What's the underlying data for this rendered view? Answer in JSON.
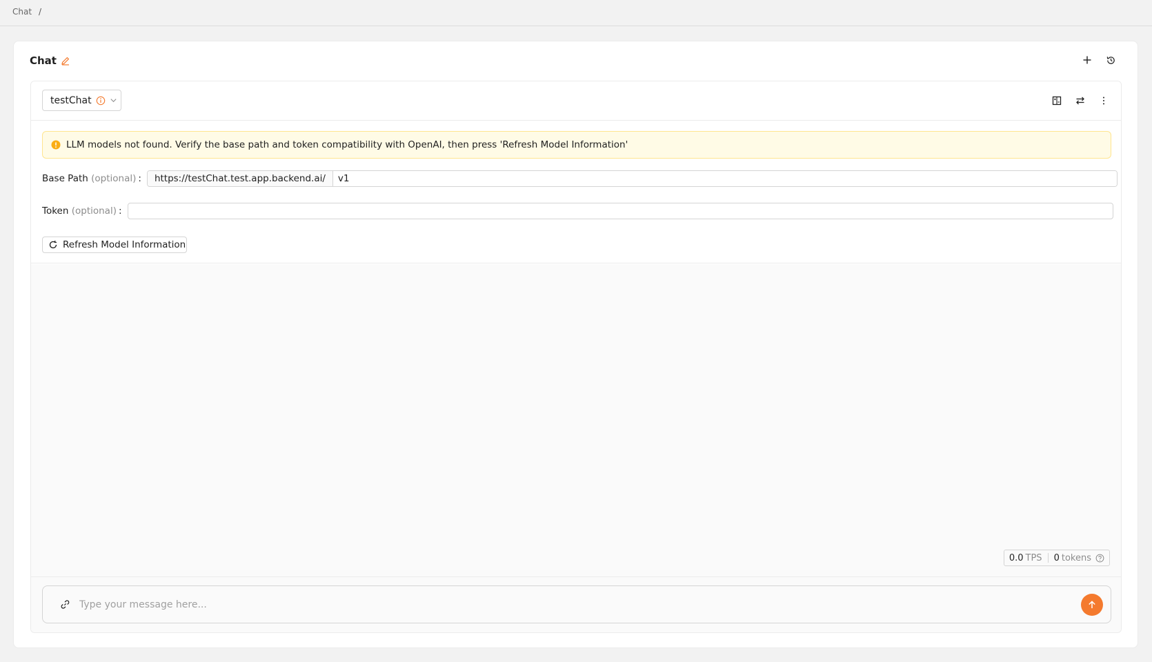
{
  "breadcrumb": {
    "root": "Chat",
    "separator": "/"
  },
  "card": {
    "title": "Chat"
  },
  "model_select": {
    "value": "testChat"
  },
  "alert": {
    "message": "LLM models not found. Verify the base path and token compatibility with OpenAI, then press 'Refresh Model Information'"
  },
  "base_path": {
    "label": "Base Path",
    "optional": "(optional)",
    "colon": ":",
    "prefix": "https://testChat.test.app.backend.ai/",
    "value": "v1"
  },
  "token": {
    "label": "Token",
    "optional": "(optional)",
    "colon": ":",
    "value": ""
  },
  "refresh_button": {
    "label": "Refresh Model Information"
  },
  "stats": {
    "tps_value": "0.0",
    "tps_unit": "TPS",
    "tokens_value": "0",
    "tokens_unit": "tokens"
  },
  "composer": {
    "placeholder": "Type your message here..."
  },
  "colors": {
    "accent": "#f47a2e",
    "warning_bg": "#fffbe6",
    "warning_border": "#ffe58f",
    "warning_icon": "#faad14"
  },
  "icons": [
    "edit-icon",
    "plus-icon",
    "history-icon",
    "info-icon",
    "chevron-down-icon",
    "compare-icon",
    "sync-icon",
    "more-vertical-icon",
    "warning-icon",
    "refresh-icon",
    "help-icon",
    "link-icon",
    "arrow-up-icon"
  ]
}
